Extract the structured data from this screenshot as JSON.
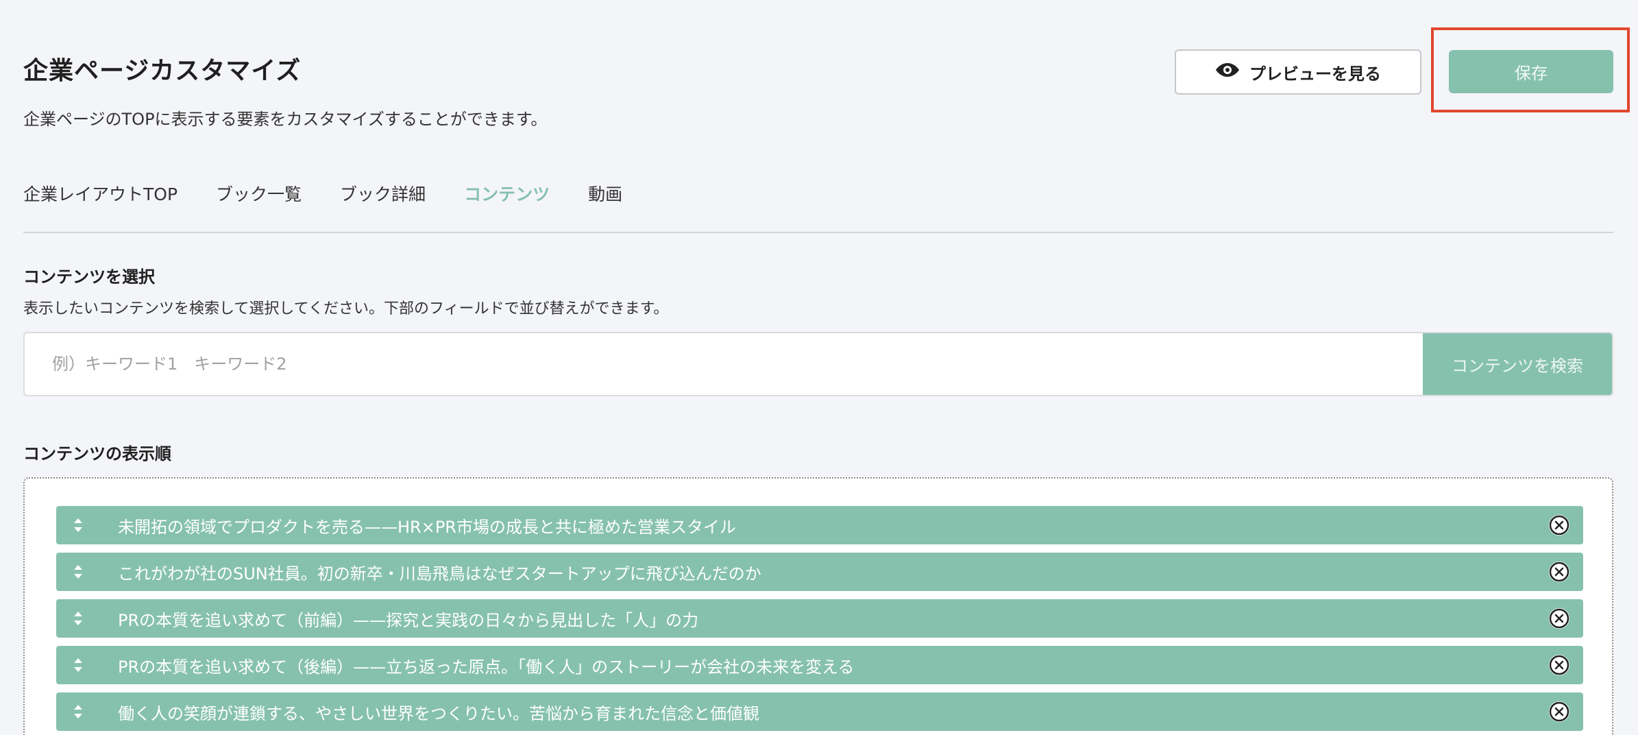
{
  "header": {
    "title": "企業ページカスタマイズ",
    "description": "企業ページのTOPに表示する要素をカスタマイズすることができます。",
    "preview_label": "プレビューを見る",
    "save_label": "保存"
  },
  "tabs": [
    {
      "label": "企業レイアウトTOP",
      "active": false
    },
    {
      "label": "ブック一覧",
      "active": false
    },
    {
      "label": "ブック詳細",
      "active": false
    },
    {
      "label": "コンテンツ",
      "active": true
    },
    {
      "label": "動画",
      "active": false
    }
  ],
  "select_section": {
    "title": "コンテンツを選択",
    "description": "表示したいコンテンツを検索して選択してください。下部のフィールドで並び替えができます。",
    "search_placeholder": "例）キーワード1　キーワード2",
    "search_value": "",
    "search_button_label": "コンテンツを検索"
  },
  "order_section": {
    "title": "コンテンツの表示順",
    "items": [
      "未開拓の領域でプロダクトを売る——HR×PR市場の成長と共に極めた営業スタイル",
      "これがわが社のSUN社員。初の新卒・川島飛鳥はなぜスタートアップに飛び込んだのか",
      "PRの本質を追い求めて（前編）——探究と実践の日々から見出した「人」の力",
      "PRの本質を追い求めて（後編）——立ち返った原点。「働く人」のストーリーが会社の未来を変える",
      "働く人の笑顔が連鎖する、やさしい世界をつくりたい。苦悩から育まれた信念と価値観"
    ]
  },
  "icons": {
    "preview": "eye-icon",
    "drag": "sort-arrows-icon",
    "remove": "close-circle-icon"
  },
  "colors": {
    "accent": "#86c1ae",
    "highlight": "#e2472e",
    "background": "#f4f5f9"
  }
}
